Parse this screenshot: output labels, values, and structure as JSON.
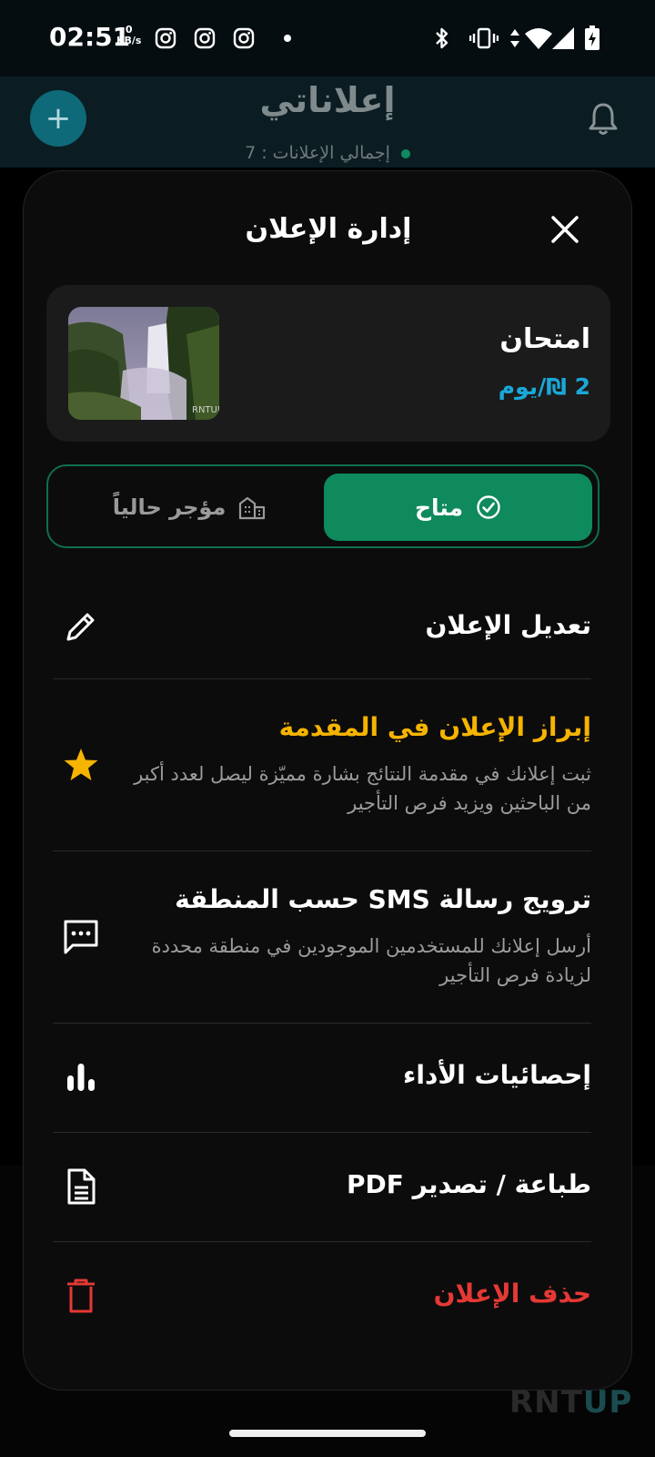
{
  "status_bar": {
    "time": "02:51",
    "speed_value": "0",
    "speed_unit": "KB/s"
  },
  "header": {
    "title": "إعلاناتي",
    "subtitle": "إجمالي الإعلانات : 7"
  },
  "sheet": {
    "title": "إدارة الإعلان",
    "ad": {
      "name": "امتحان",
      "price": "2 ₪/يوم",
      "thumb_watermark": "RNTUP"
    },
    "status": {
      "available_label": "متاح",
      "rented_label": "مؤجر حالياً"
    },
    "actions": {
      "edit": {
        "label": "تعديل الإعلان"
      },
      "feature": {
        "label": "إبراز الإعلان في المقدمة",
        "desc": "ثبت إعلانك في مقدمة النتائج بشارة مميّزة ليصل لعدد أكبر من الباحثين ويزيد فرص التأجير"
      },
      "sms": {
        "label": "ترويج رسالة SMS حسب المنطقة",
        "desc": "أرسل إعلانك للمستخدمين الموجودين في منطقة محددة لزيادة فرص التأجير"
      },
      "stats": {
        "label": "إحصائيات الأداء"
      },
      "pdf": {
        "label": "طباعة / تصدير PDF"
      },
      "delete": {
        "label": "حذف الإعلان"
      }
    }
  },
  "branding": {
    "logo_part1": "RNT",
    "logo_part2": "UP"
  },
  "colors": {
    "accent_green": "#0e8a5c",
    "price_blue": "#1aa8d8",
    "feature_gold": "#f5b400",
    "delete_red": "#e53935"
  }
}
